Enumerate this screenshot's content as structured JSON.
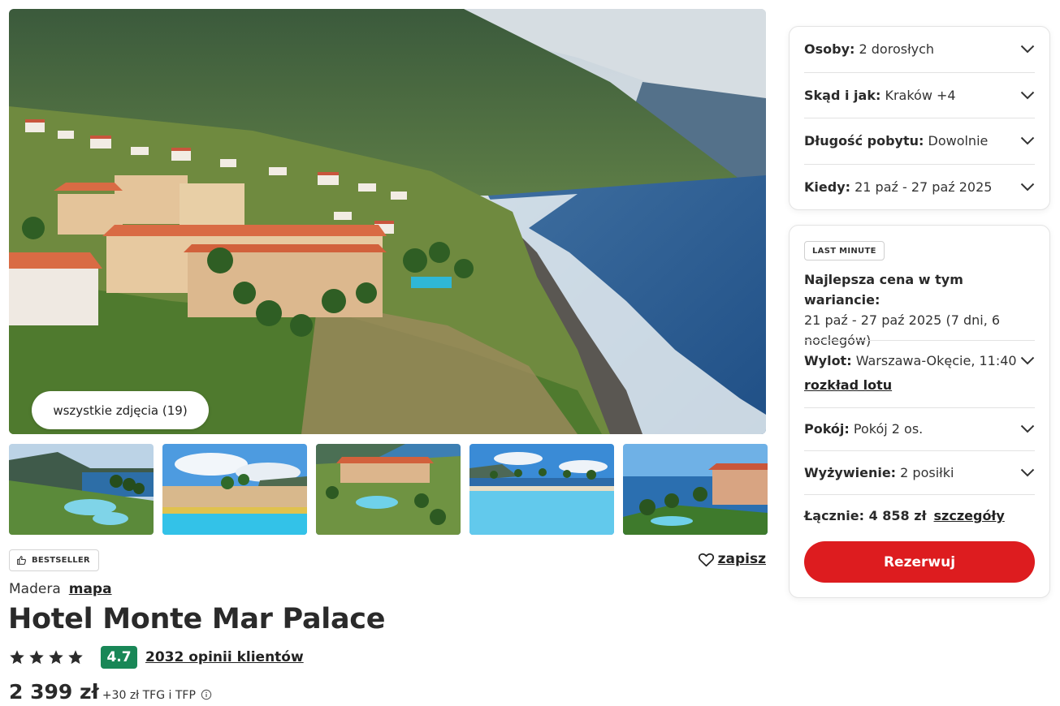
{
  "gallery": {
    "all_photos_label": "wszystkie zdjęcia (19)",
    "thumbnails": [
      "thumbnail-cliff-pool",
      "thumbnail-pool-sky",
      "thumbnail-hotel-aerial",
      "thumbnail-infinity-pool",
      "thumbnail-hotel-ocean"
    ]
  },
  "hotel": {
    "badge": "BESTSELLER",
    "save_label": "zapisz",
    "region": "Madera",
    "map_label": "mapa",
    "name": "Hotel Monte Mar Palace",
    "stars": 4,
    "score": "4.7",
    "reviews_label": "2032 opinii klientów",
    "price": "2 399 zł",
    "price_extra": "+30 zł TFG i TFP"
  },
  "filters": [
    {
      "label": "Osoby:",
      "value": "2 dorosłych"
    },
    {
      "label": "Skąd i jak:",
      "value": "Kraków +4"
    },
    {
      "label": "Długość pobytu:",
      "value": "Dowolnie"
    },
    {
      "label": "Kiedy:",
      "value": "21 paź - 27 paź 2025"
    }
  ],
  "offer": {
    "badge": "LAST MINUTE",
    "best_price_heading": "Najlepsza cena w tym wariancie:",
    "best_price_dates": "21 paź - 27 paź 2025 (7 dni, 6 noclegów)",
    "flight": {
      "label": "Wylot:",
      "value": "Warszawa-Okęcie, 11:40",
      "link": "rozkład lotu"
    },
    "room": {
      "label": "Pokój:",
      "value": "Pokój 2 os."
    },
    "board": {
      "label": "Wyżywienie:",
      "value": "2 posiłki"
    },
    "total": {
      "label": "Łącznie:",
      "value": "4 858 zł",
      "details": "szczegóły"
    },
    "reserve_label": "Rezerwuj"
  },
  "colors": {
    "accent_red": "#dd1c1f",
    "score_green": "#198757"
  }
}
